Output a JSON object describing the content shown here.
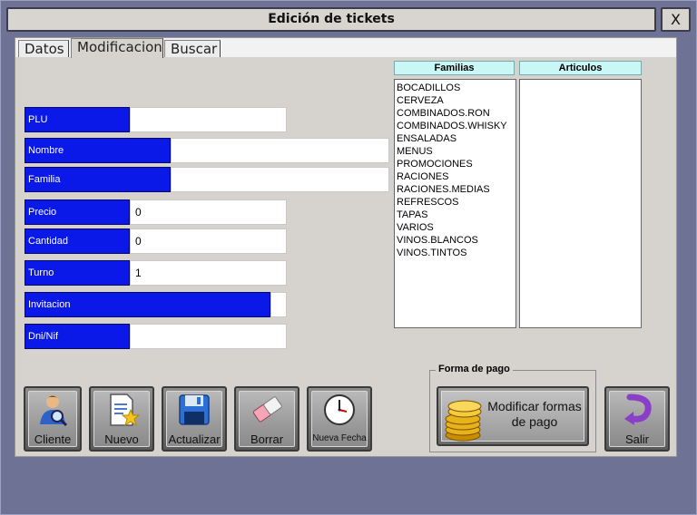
{
  "window": {
    "title": "Edición de tickets",
    "close_label": "X"
  },
  "tabs": [
    {
      "label": "Datos"
    },
    {
      "label": "Modificacion"
    },
    {
      "label": "Buscar"
    }
  ],
  "fields": {
    "plu": {
      "label": "PLU",
      "value": ""
    },
    "nombre": {
      "label": "Nombre",
      "value": ""
    },
    "familia": {
      "label": "Familia",
      "value": ""
    },
    "precio": {
      "label": "Precio",
      "value": "0"
    },
    "cantidad": {
      "label": "Cantidad",
      "value": "0"
    },
    "turno": {
      "label": "Turno",
      "value": "1"
    },
    "invitacion": {
      "label": "Invitacion",
      "value": ""
    },
    "dni": {
      "label": "Dni/Nif",
      "value": ""
    }
  },
  "familias": {
    "header": "Familias",
    "items": [
      "BOCADILLOS",
      "CERVEZA",
      "COMBINADOS.RON",
      "COMBINADOS.WHISKY",
      "ENSALADAS",
      "MENUS",
      "PROMOCIONES",
      "RACIONES",
      "RACIONES.MEDIAS",
      "REFRESCOS",
      "TAPAS",
      "VARIOS",
      "VINOS.BLANCOS",
      "VINOS.TINTOS"
    ]
  },
  "articulos": {
    "header": "Articulos",
    "items": []
  },
  "buttons": {
    "cliente": "Cliente",
    "nuevo": "Nuevo",
    "actualizar": "Actualizar",
    "borrar": "Borrar",
    "nueva_fecha": "Nueva Fecha",
    "salir": "Salir"
  },
  "forma_pago": {
    "title": "Forma de pago",
    "button_label": "Modificar formas de pago"
  },
  "colors": {
    "label_blue": "#0a18e8",
    "list_header_cyan": "#c8f7f6",
    "panel_gray": "#d6d3ce",
    "background": "#6e7396"
  }
}
